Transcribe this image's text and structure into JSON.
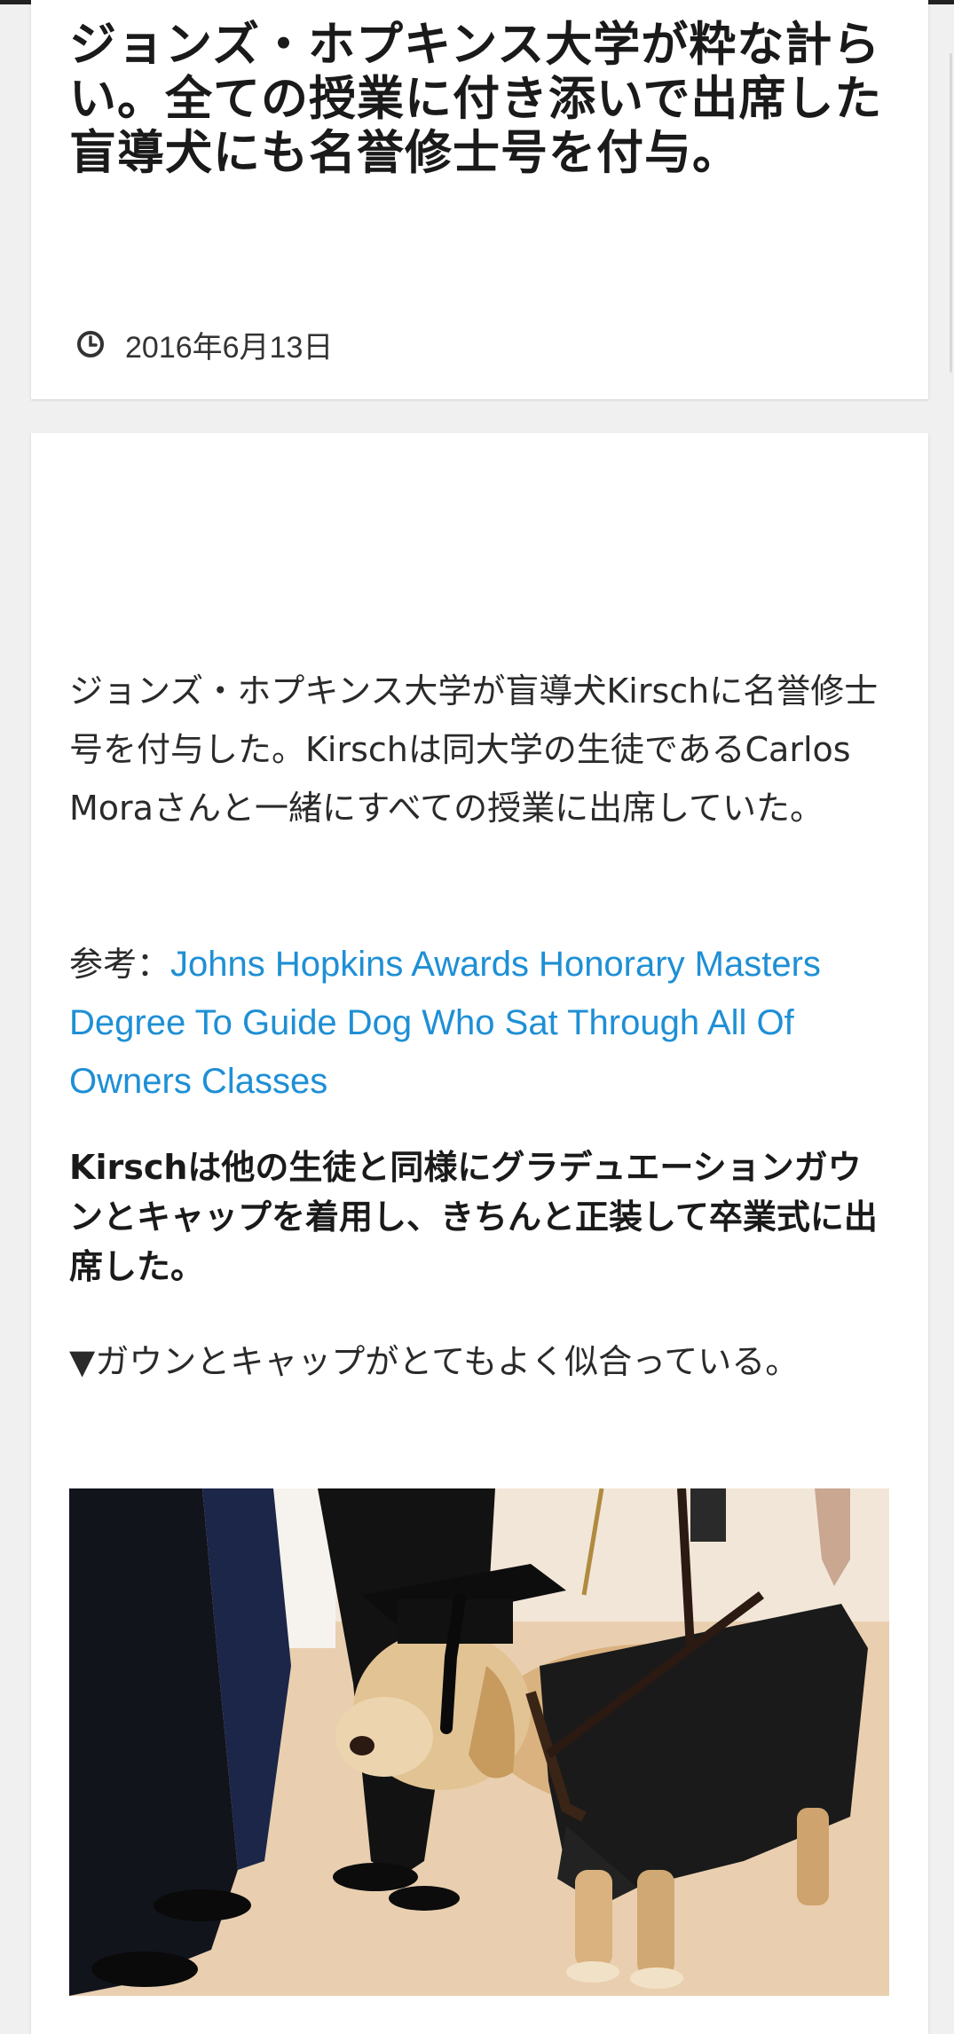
{
  "article": {
    "title": "ジョンズ・ホプキンス大学が粋な計らい。全ての授業に付き添いで出席した盲導犬にも名誉修士号を付与。",
    "date": "2016年6月13日",
    "date_icon": "clock-icon"
  },
  "body": {
    "intro": "ジョンズ・ホプキンス大学が盲導犬Kirschに名誉修士号を付与した。Kirschは同大学の生徒であるCarlos Moraさんと一緒にすべての授業に出席していた。",
    "reference_prefix": "参考：",
    "reference_link": "Johns Hopkins Awards Honorary Masters Degree To Guide Dog Who Sat Through All Of Owners Classes",
    "bold_paragraph": "Kirschは他の生徒と同様にグラデュエーションガウンとキャップを着用し、きちんと正装して卒業式に出席した。",
    "caption": "▼ガウンとキャップがとてもよく似合っている。"
  },
  "colors": {
    "link": "#1e8fd5",
    "card": "#ffffff",
    "page_bg": "#f0f0f0"
  }
}
